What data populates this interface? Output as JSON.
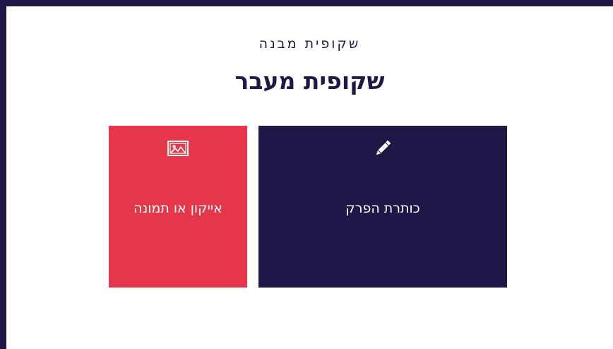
{
  "slide": {
    "subtitle": "שקופית מבנה",
    "title": "שקופית מעבר"
  },
  "cards": [
    {
      "label": "אייקון או תמונה",
      "icon": "image-icon",
      "color": "#e6364a"
    },
    {
      "label": "כותרת הפרק",
      "icon": "pencil-icon",
      "color": "#1e1849"
    }
  ],
  "colors": {
    "frame": "#1e1849",
    "background": "#ffffff",
    "accent_red": "#e6364a",
    "navy": "#1e1849"
  }
}
